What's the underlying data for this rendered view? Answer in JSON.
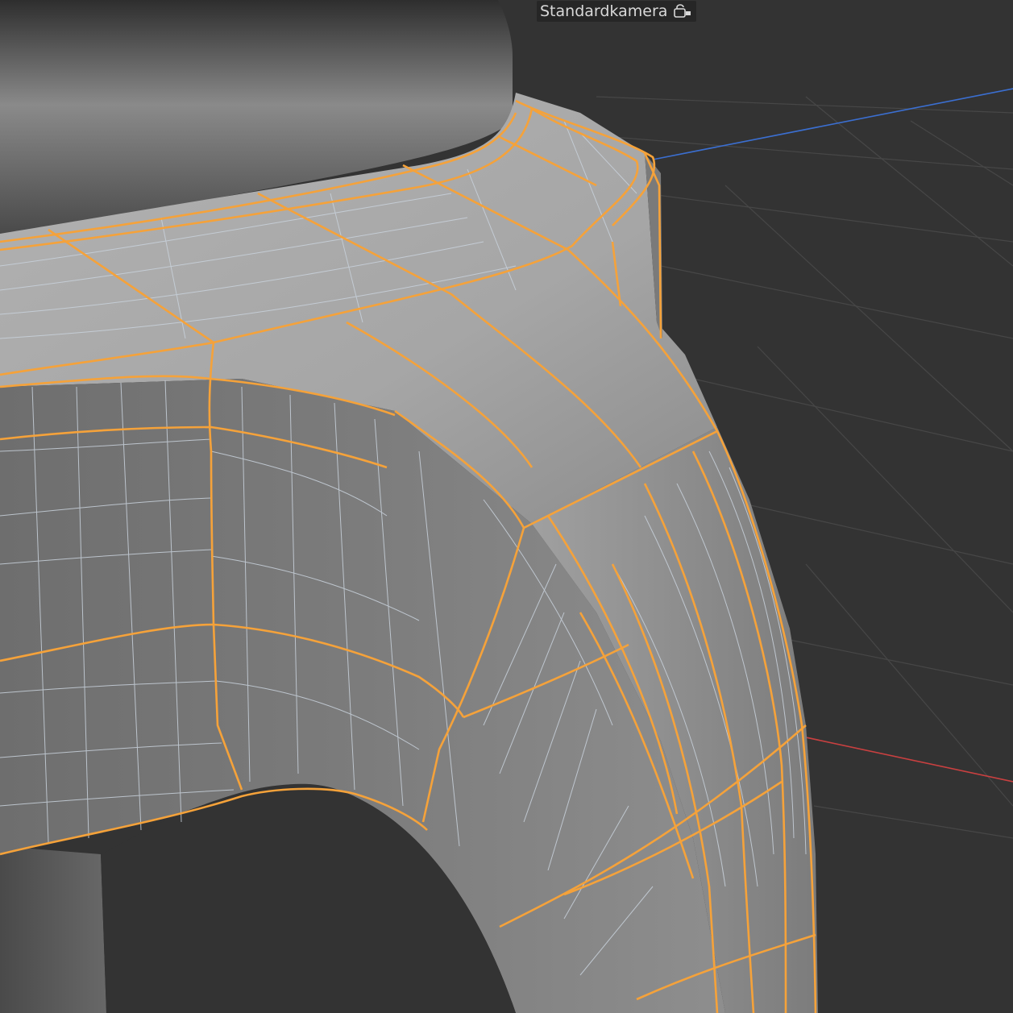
{
  "viewport": {
    "camera_label": "Standardkamera",
    "camera_icon": "camera-lock-icon"
  },
  "colors": {
    "background": "#333333",
    "grid": "#474747",
    "axis_x": "#c94040",
    "axis_z": "#3b6fd1",
    "mesh_surface": "#9a9a9a",
    "wire_fine": "#c9d2dc",
    "wire_edge_loop": "#f5a23a"
  }
}
